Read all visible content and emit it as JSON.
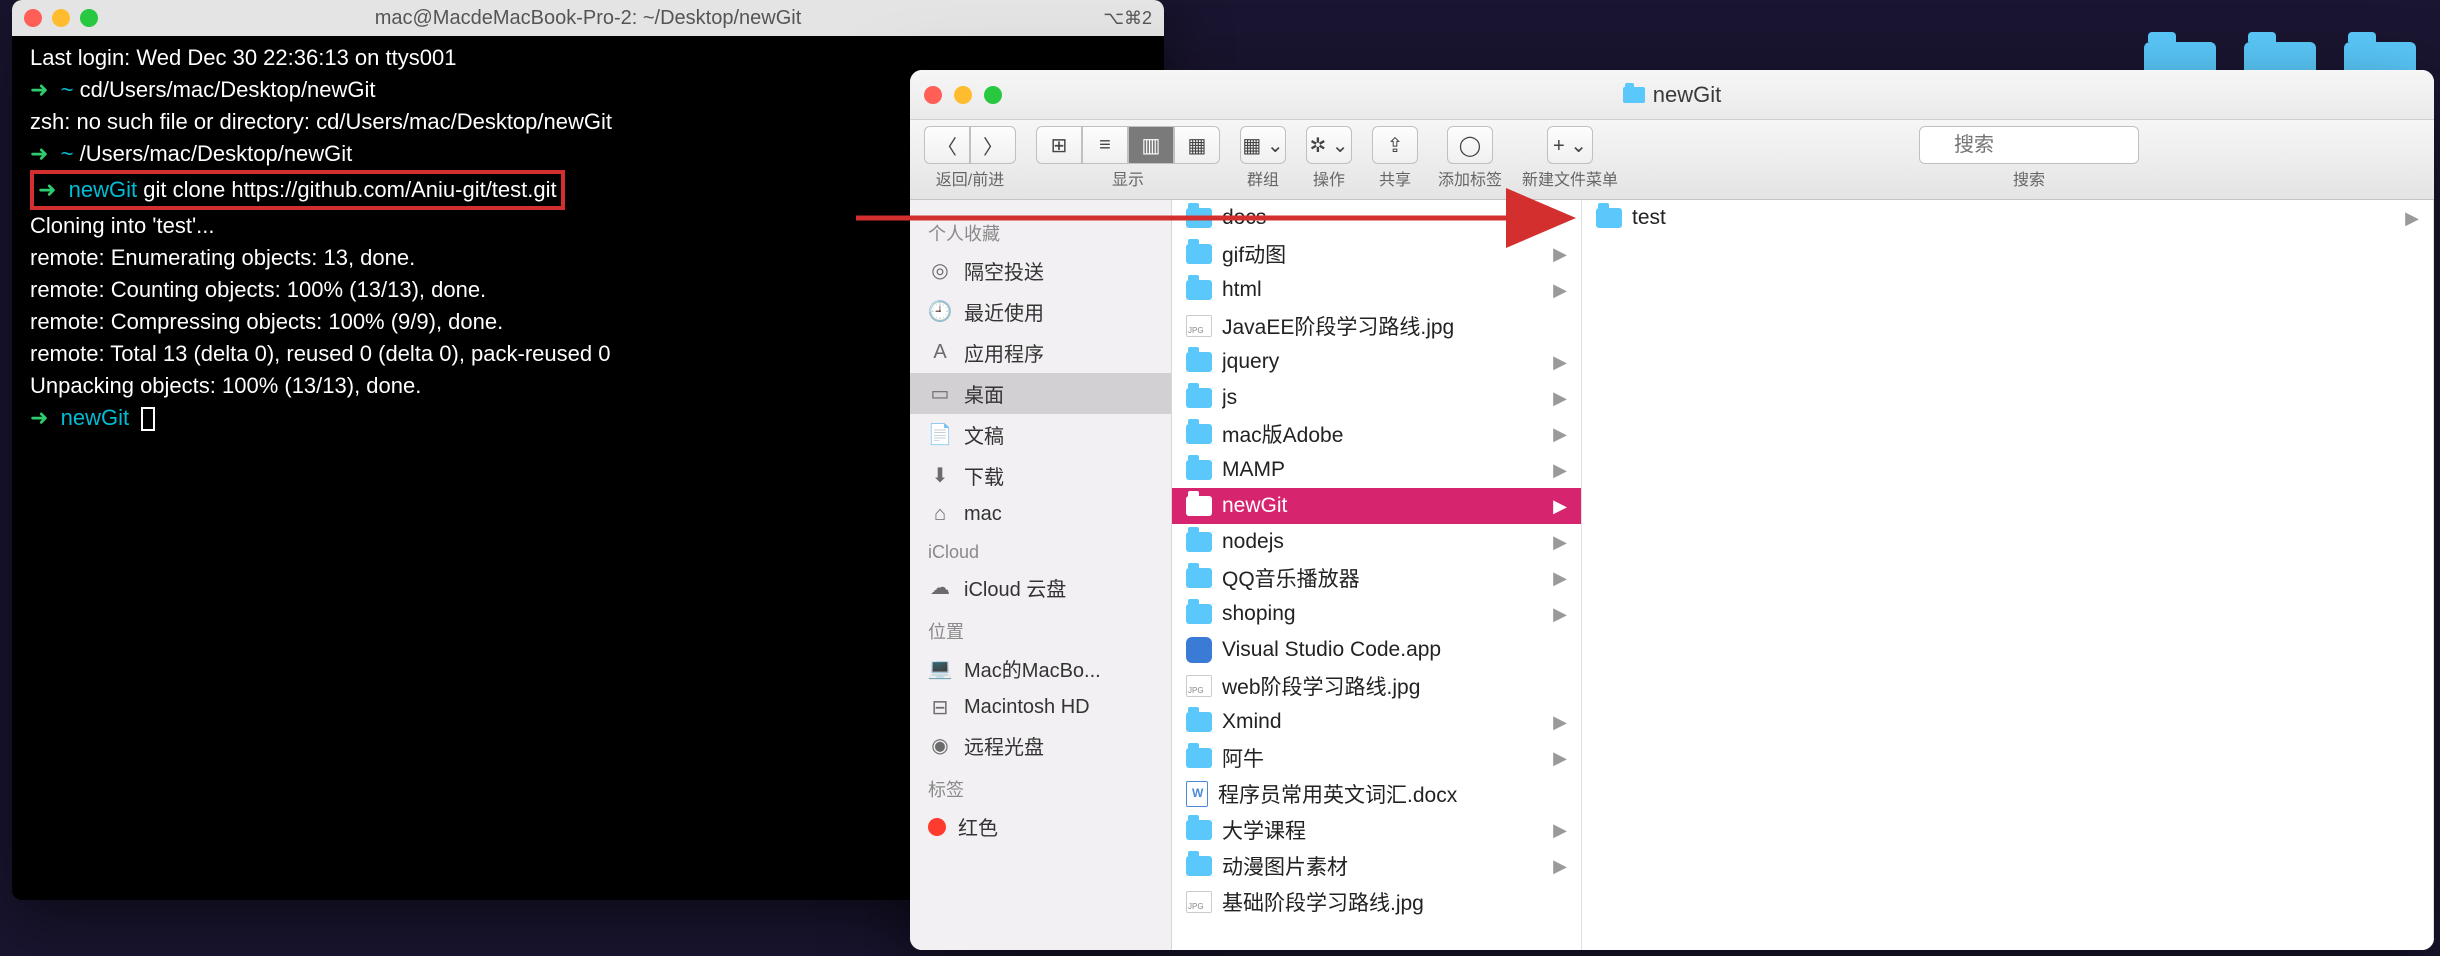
{
  "terminal": {
    "title": "mac@MacdeMacBook-Pro-2: ~/Desktop/newGit",
    "right_indicator": "⌥⌘2",
    "lines": {
      "l1": "Last login: Wed Dec 30 22:36:13 on ttys001",
      "l2_dir": "~",
      "l2_cmd": "cd/Users/mac/Desktop/newGit",
      "l3": "zsh: no such file or directory: cd/Users/mac/Desktop/newGit",
      "l4_dir": "~",
      "l4_cmd": "/Users/mac/Desktop/newGit",
      "l5_dir": "newGit",
      "l5_cmd": "git clone https://github.com/Aniu-git/test.git",
      "l6": "Cloning into 'test'...",
      "l7": "remote: Enumerating objects: 13, done.",
      "l8": "remote: Counting objects: 100% (13/13), done.",
      "l9": "remote: Compressing objects: 100% (9/9), done.",
      "l10": "remote: Total 13 (delta 0), reused 0 (delta 0), pack-reused 0",
      "l11": "Unpacking objects: 100% (13/13), done.",
      "l12_dir": "newGit"
    }
  },
  "finder": {
    "title": "newGit",
    "toolbar": {
      "back_fwd": "返回/前进",
      "view": "显示",
      "group": "群组",
      "action": "操作",
      "share": "共享",
      "tags": "添加标签",
      "new_folder": "新建文件菜单",
      "search_label": "搜索",
      "search_placeholder": "搜索"
    },
    "sidebar": {
      "favorites_head": "个人收藏",
      "favorites": [
        {
          "icon": "◎",
          "label": "隔空投送"
        },
        {
          "icon": "🕘",
          "label": "最近使用"
        },
        {
          "icon": "A",
          "label": "应用程序"
        },
        {
          "icon": "▭",
          "label": "桌面"
        },
        {
          "icon": "📄",
          "label": "文稿"
        },
        {
          "icon": "⬇",
          "label": "下载"
        },
        {
          "icon": "⌂",
          "label": "mac"
        }
      ],
      "icloud_head": "iCloud",
      "icloud": [
        {
          "icon": "☁",
          "label": "iCloud 云盘"
        }
      ],
      "locations_head": "位置",
      "locations": [
        {
          "icon": "💻",
          "label": "Mac的MacBo..."
        },
        {
          "icon": "⊟",
          "label": "Macintosh HD"
        },
        {
          "icon": "◉",
          "label": "远程光盘"
        }
      ],
      "tags_head": "标签",
      "tags": [
        {
          "color": "#ff3b30",
          "label": "红色"
        }
      ]
    },
    "col1": [
      {
        "type": "folder",
        "name": "docs",
        "chev": true
      },
      {
        "type": "folder",
        "name": "gif动图",
        "chev": true
      },
      {
        "type": "folder",
        "name": "html",
        "chev": true
      },
      {
        "type": "img",
        "name": "JavaEE阶段学习路线.jpg",
        "chev": false
      },
      {
        "type": "folder",
        "name": "jquery",
        "chev": true
      },
      {
        "type": "folder",
        "name": "js",
        "chev": true
      },
      {
        "type": "folder",
        "name": "mac版Adobe",
        "chev": true
      },
      {
        "type": "folder",
        "name": "MAMP",
        "chev": true
      },
      {
        "type": "folder",
        "name": "newGit",
        "chev": true,
        "selected": true
      },
      {
        "type": "folder",
        "name": "nodejs",
        "chev": true
      },
      {
        "type": "folder",
        "name": "QQ音乐播放器",
        "chev": true
      },
      {
        "type": "folder",
        "name": "shoping",
        "chev": true
      },
      {
        "type": "app",
        "name": "Visual Studio Code.app",
        "chev": false
      },
      {
        "type": "img",
        "name": "web阶段学习路线.jpg",
        "chev": false
      },
      {
        "type": "folder",
        "name": "Xmind",
        "chev": true
      },
      {
        "type": "folder",
        "name": "阿牛",
        "chev": true
      },
      {
        "type": "doc",
        "name": "程序员常用英文词汇.docx",
        "chev": false
      },
      {
        "type": "folder",
        "name": "大学课程",
        "chev": true
      },
      {
        "type": "folder",
        "name": "动漫图片素材",
        "chev": true
      },
      {
        "type": "img",
        "name": "基础阶段学习路线.jpg",
        "chev": false
      }
    ],
    "col2": [
      {
        "type": "folder",
        "name": "test",
        "chev": true
      }
    ]
  }
}
